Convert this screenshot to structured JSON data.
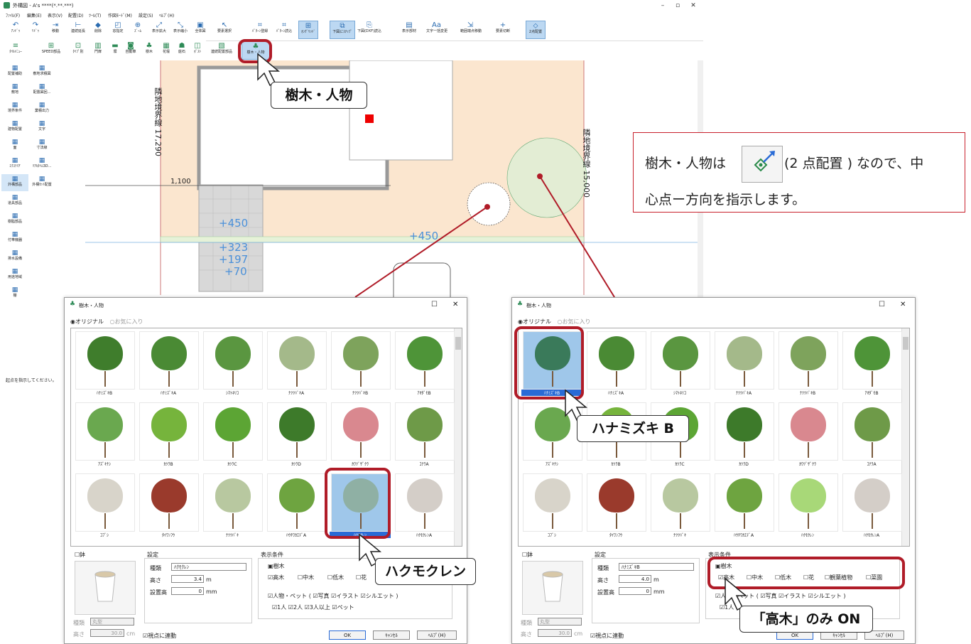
{
  "window": {
    "title": "外構図 - A's ****(*.**.***)",
    "minimize": "–",
    "maximize": "▫",
    "close": "✕"
  },
  "menu": [
    "ﾌｧｲﾙ(F)",
    "編集(E)",
    "表示(V)",
    "配置(D)",
    "ﾂｰﾙ(T)",
    "作図ﾓｰﾄﾞ(M)",
    "設定(S)",
    "ﾍﾙﾌﾟ(H)"
  ],
  "toolbar1": [
    {
      "label": "ｱﾝﾄﾞｩ",
      "icon": "undo-icon",
      "glyph": "↶"
    },
    {
      "label": "ﾘﾄﾞｩ",
      "icon": "redo-icon",
      "glyph": "↷"
    },
    {
      "label": "移動",
      "icon": "move-icon",
      "glyph": "⇥"
    },
    {
      "label": "連続延長",
      "icon": "extend-icon",
      "glyph": "⊢"
    },
    {
      "label": "削除",
      "icon": "delete-icon",
      "glyph": "◆"
    },
    {
      "label": "窓指定",
      "icon": "window-select-icon",
      "glyph": "◰"
    },
    {
      "label": "ｽﾞｰﾑ",
      "icon": "zoom-icon",
      "glyph": "⊕"
    },
    {
      "label": "表示拡大",
      "icon": "zoom-in-icon",
      "glyph": "⤢"
    },
    {
      "label": "表示縮小",
      "icon": "zoom-out-icon",
      "glyph": "⤡"
    },
    {
      "label": "全体図",
      "icon": "fit-all-icon",
      "glyph": "▣"
    },
    {
      "label": "要素選択",
      "icon": "select-pointer-icon",
      "glyph": "↖"
    },
    {
      "label": "ﾊﾟﾀｰﾝ登録",
      "icon": "pattern-register-icon",
      "glyph": "⌗"
    },
    {
      "label": "ﾊﾟﾀｰﾝ読込",
      "icon": "pattern-load-icon",
      "glyph": "⌗"
    },
    {
      "label": "ｵﾝｸﾞﾘｯﾄﾞ",
      "icon": "on-grid-icon",
      "glyph": "⊞"
    },
    {
      "label": "下図にｽﾅｯﾌﾟ",
      "icon": "snap-icon",
      "glyph": "⧉"
    },
    {
      "label": "下図(DXF)読込",
      "icon": "dxf-load-icon",
      "glyph": "⎘"
    },
    {
      "label": "表示部材",
      "icon": "display-parts-icon",
      "glyph": "▤"
    },
    {
      "label": "文字一括変更",
      "icon": "text-change-icon",
      "glyph": "Aa"
    },
    {
      "label": "範囲端点移動",
      "icon": "range-move-icon",
      "glyph": "⇲"
    },
    {
      "label": "要素切断",
      "icon": "cut-icon",
      "glyph": "+"
    },
    {
      "label": "2点配置",
      "icon": "two-point-icon",
      "glyph": "⬦"
    }
  ],
  "toolbar2": [
    {
      "label": "ﾀｲﾙﾒﾆｭｰ",
      "icon": "menu-icon",
      "glyph": "≡"
    },
    {
      "label": "SPEED部品",
      "icon": "speed-parts-icon",
      "glyph": "⊞"
    },
    {
      "label": "ﾀｲﾌﾟ別",
      "icon": "type-icon",
      "glyph": "⊡"
    },
    {
      "label": "門扉",
      "icon": "gate-icon",
      "glyph": "▥"
    },
    {
      "label": "塀",
      "icon": "wall-icon",
      "glyph": "▬"
    },
    {
      "label": "自動車",
      "icon": "car-icon",
      "glyph": "◙"
    },
    {
      "label": "樹木",
      "icon": "tree-icon",
      "glyph": "♣"
    },
    {
      "label": "花壇",
      "icon": "flowerbed-icon",
      "glyph": "▦"
    },
    {
      "label": "庭石",
      "icon": "stone-icon",
      "glyph": "☗"
    },
    {
      "label": "ﾎﾟｽﾄ",
      "icon": "post-icon",
      "glyph": "◫"
    },
    {
      "label": "連続配置部品",
      "icon": "continuous-parts-icon",
      "glyph": "▧"
    },
    {
      "label": "樹木・人物",
      "icon": "tree-person-icon",
      "glyph": "♣"
    }
  ],
  "leftpanel": [
    {
      "label": "配置補助",
      "icon": "placement-aid-icon"
    },
    {
      "label": "敷地求積図",
      "icon": "site-area-icon"
    },
    {
      "label": "敷地",
      "icon": "site-icon"
    },
    {
      "label": "配置図回...",
      "icon": "layout-icon"
    },
    {
      "label": "境界条件",
      "icon": "boundary-icon"
    },
    {
      "label": "業積出力",
      "icon": "output-icon"
    },
    {
      "label": "建物配置",
      "icon": "building-icon"
    },
    {
      "label": "文字",
      "icon": "text-icon"
    },
    {
      "label": "面",
      "icon": "surface-icon"
    },
    {
      "label": "寸法線",
      "icon": "dimension-icon"
    },
    {
      "label": "ｴｸｽﾃﾘｱ",
      "icon": "exterior-icon"
    },
    {
      "label": "ﾘｱﾙﾀｲﾑ3D...",
      "icon": "realtime-3d-icon"
    },
    {
      "label": "外構部品",
      "icon": "exterior-parts-icon"
    },
    {
      "label": "外構ｾｯﾄ配置",
      "icon": "set-placement-icon"
    },
    {
      "label": "道具部品",
      "icon": "tool-parts-icon"
    },
    {
      "label": "樹脂部品",
      "icon": "resin-parts-icon"
    },
    {
      "label": "付帯機器",
      "icon": "equipment-icon"
    },
    {
      "label": "排水設備",
      "icon": "drain-icon"
    },
    {
      "label": "用途地域",
      "icon": "zoning-icon"
    },
    {
      "label": "棚",
      "icon": "shelf-icon"
    }
  ],
  "status": "起点を指示してください。",
  "canvas": {
    "boundary_left": "隣地境界線 17,290",
    "boundary_right": "隣地境界線 15,000",
    "dim_1100": "1,100",
    "levels": [
      "+450",
      "+323",
      "+197",
      "+70",
      "+450"
    ]
  },
  "callouts": {
    "tree_person": "樹木・人物",
    "hanamizuki": "ハナミズキ B",
    "hakumokuren": "ハクモクレン",
    "high_only": "「高木」のみ ON"
  },
  "infobox": {
    "line1a": "樹木・人物は",
    "line1b": "(2 点配置 ) なので、中",
    "line2": "心点ー方向を指示します。"
  },
  "dialog_common": {
    "title": "樹木・人物",
    "radio_original": "◉オリジナル",
    "radio_fav": "○お気に入り",
    "pot_label": "☐鉢",
    "pot_type_label": "種類",
    "pot_type_value": "丸型",
    "pot_height_label": "高さ",
    "pot_height_value": "30.0",
    "pot_unit": "cm",
    "settings_label": "設定",
    "type_label": "種類",
    "height_label": "高さ",
    "height_unit": "m",
    "install_label": "設置高",
    "install_value": "0",
    "install_unit": "mm",
    "display_label": "表示条件",
    "view_link": "☑視点に連動",
    "ok": "OK",
    "cancel": "ｷｬﾝｾﾙ",
    "help": "ﾍﾙﾌﾟ(H)"
  },
  "dialog_left": {
    "type_value": "ﾊｸﾓｸﾚﾝ",
    "height_value": "3.4",
    "tree_cat": "▣樹木",
    "chk_high": "☑高木",
    "chk_mid": "☐中木",
    "chk_low": "☐低木",
    "chk_flower": "☐花",
    "person_row": "☑人物・ペット ( ☑写真 ☑イラスト ☑シルエット )",
    "count_row": "☑1人 ☑2人 ☑3人以上 ☑ペット"
  },
  "dialog_right": {
    "type_value": "ﾊﾅﾐｽﾞｷB",
    "height_value": "4.0",
    "tree_cat": "▣樹木",
    "chk_high": "☑高木",
    "chk_mid": "☐中木",
    "chk_low": "☐低木",
    "chk_flower": "☐花",
    "chk_foliage": "☐観葉植物",
    "chk_fruit": "☐菜園",
    "person_row": "☑人物・ペット ( ☑写真 ☑イラスト ☑シルエット )",
    "count_row": "☑1人"
  },
  "trees_left": [
    {
      "name": "ﾊﾅﾐｽﾞｷB",
      "color": "#3f7d2c"
    },
    {
      "name": "ﾊﾅﾐｽﾞｷA",
      "color": "#4a8a34"
    },
    {
      "name": "ｼﾏﾄﾈﾘｺ",
      "color": "#5a9640"
    },
    {
      "name": "ﾅﾂﾂﾊﾞｷA",
      "color": "#a4b98a"
    },
    {
      "name": "ﾅﾂﾂﾊﾞｷB",
      "color": "#7ea35c"
    },
    {
      "name": "ｱｵﾀﾞﾓB",
      "color": "#4e9438"
    },
    {
      "name": "ｱｽﾞｷﾅｼ",
      "color": "#6aa84f"
    },
    {
      "name": "ｶﾂﾗB",
      "color": "#76b43c"
    },
    {
      "name": "ｶﾂﾗC",
      "color": "#5ca534"
    },
    {
      "name": "ｶﾂﾗD",
      "color": "#3d7a2a"
    },
    {
      "name": "ｶﾜﾂﾞｻﾞｸﾗ",
      "color": "#d9888f"
    },
    {
      "name": "ｺﾅﾗA",
      "color": "#6e9a48"
    },
    {
      "name": "ｺﾌﾞｼ",
      "color": "#d8d4ca"
    },
    {
      "name": "ﾀｲﾜﾝﾌｳ",
      "color": "#9a3a2c"
    },
    {
      "name": "ﾅﾂﾂﾊﾞｷ",
      "color": "#b8c8a0"
    },
    {
      "name": "ﾊｳﾁﾜｶｴﾃﾞA",
      "color": "#6ea440"
    },
    {
      "name": "ﾊｸﾓｸﾚﾝ",
      "color": "#8fb0a4"
    },
    {
      "name": "ﾊｸﾓｸﾚﾝA",
      "color": "#d4cec8"
    }
  ],
  "trees_right": [
    {
      "name": "ﾊﾅﾐｽﾞｷB",
      "color": "#3a7a5a"
    },
    {
      "name": "ﾊﾅﾐｽﾞｷA",
      "color": "#4a8a34"
    },
    {
      "name": "ｼﾏﾄﾈﾘｺ",
      "color": "#5a9640"
    },
    {
      "name": "ﾅﾂﾂﾊﾞｷA",
      "color": "#a4b98a"
    },
    {
      "name": "ﾅﾂﾂﾊﾞｷB",
      "color": "#7ea35c"
    },
    {
      "name": "ｱｵﾀﾞﾓB",
      "color": "#4e9438"
    },
    {
      "name": "ｱｽﾞｷﾅｼ",
      "color": "#6aa84f"
    },
    {
      "name": "ｶﾂﾗB",
      "color": "#76b43c"
    },
    {
      "name": "ｶﾂﾗC",
      "color": "#5ca534"
    },
    {
      "name": "ｶﾂﾗD",
      "color": "#3d7a2a"
    },
    {
      "name": "ｶﾜﾂﾞｻﾞｸﾗ",
      "color": "#d9888f"
    },
    {
      "name": "ｺﾅﾗA",
      "color": "#6e9a48"
    },
    {
      "name": "ｺﾌﾞｼ",
      "color": "#d8d4ca"
    },
    {
      "name": "ﾀｲﾜﾝﾌｳ",
      "color": "#9a3a2c"
    },
    {
      "name": "ﾅﾂﾂﾊﾞｷ",
      "color": "#b8c8a0"
    },
    {
      "name": "ﾊｳﾁﾜｶｴﾃﾞA",
      "color": "#6ea440"
    },
    {
      "name": "ﾊｸﾓｸﾚﾝ",
      "color": "#a8d878"
    },
    {
      "name": "ﾊｸﾓｸﾚﾝA",
      "color": "#d4cec8"
    }
  ],
  "colors": {
    "accent_red": "#b01c28",
    "active_blue": "#bcd8f2",
    "site_fill": "#fbe6cf",
    "level_blue": "#4a90d9"
  }
}
